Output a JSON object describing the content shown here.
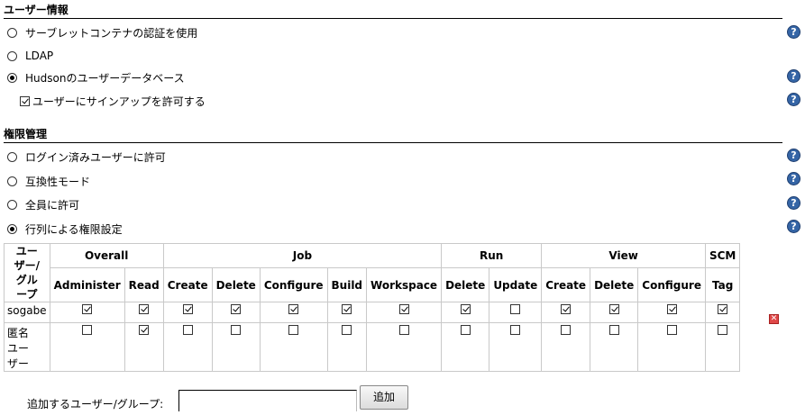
{
  "security_realm": {
    "title": "ユーザー情報",
    "options": [
      {
        "label": "サーブレットコンテナの認証を使用",
        "selected": false
      },
      {
        "label": "LDAP",
        "selected": false
      },
      {
        "label": "Hudsonのユーザーデータベース",
        "selected": true
      }
    ],
    "allow_signup": {
      "label": "ユーザーにサインアップを許可する",
      "checked": true
    }
  },
  "authorization": {
    "title": "権限管理",
    "options": [
      {
        "label": "ログイン済みユーザーに許可",
        "selected": false
      },
      {
        "label": "互換性モード",
        "selected": false
      },
      {
        "label": "全員に許可",
        "selected": false
      },
      {
        "label": "行列による権限設定",
        "selected": true
      }
    ]
  },
  "matrix": {
    "user_group_header_lines": [
      "ユー",
      "ザー/",
      "グル",
      "ープ"
    ],
    "groups": [
      {
        "name": "Overall",
        "columns": [
          "Administer",
          "Read"
        ]
      },
      {
        "name": "Job",
        "columns": [
          "Create",
          "Delete",
          "Configure",
          "Build",
          "Workspace"
        ]
      },
      {
        "name": "Run",
        "columns": [
          "Delete",
          "Update"
        ]
      },
      {
        "name": "View",
        "columns": [
          "Create",
          "Delete",
          "Configure"
        ]
      },
      {
        "name": "SCM",
        "columns": [
          "Tag"
        ]
      }
    ],
    "rows": [
      {
        "name_lines": [
          "sogabe"
        ],
        "perms": [
          true,
          true,
          true,
          true,
          true,
          true,
          true,
          true,
          false,
          true,
          true,
          true,
          true
        ],
        "deletable": true
      },
      {
        "name_lines": [
          "匿名",
          "ユー",
          "ザー"
        ],
        "perms": [
          false,
          true,
          false,
          false,
          false,
          false,
          false,
          false,
          false,
          false,
          false,
          false,
          false
        ],
        "deletable": false
      }
    ]
  },
  "add_user": {
    "label": "追加するユーザー/グループ:",
    "value": "",
    "button": "追加"
  },
  "help_glyph": "?",
  "delete_glyph": "✕",
  "colors": {
    "help_icon": "#3565a6",
    "delete_icon": "#e04848",
    "grid": "#c9c9c9"
  }
}
